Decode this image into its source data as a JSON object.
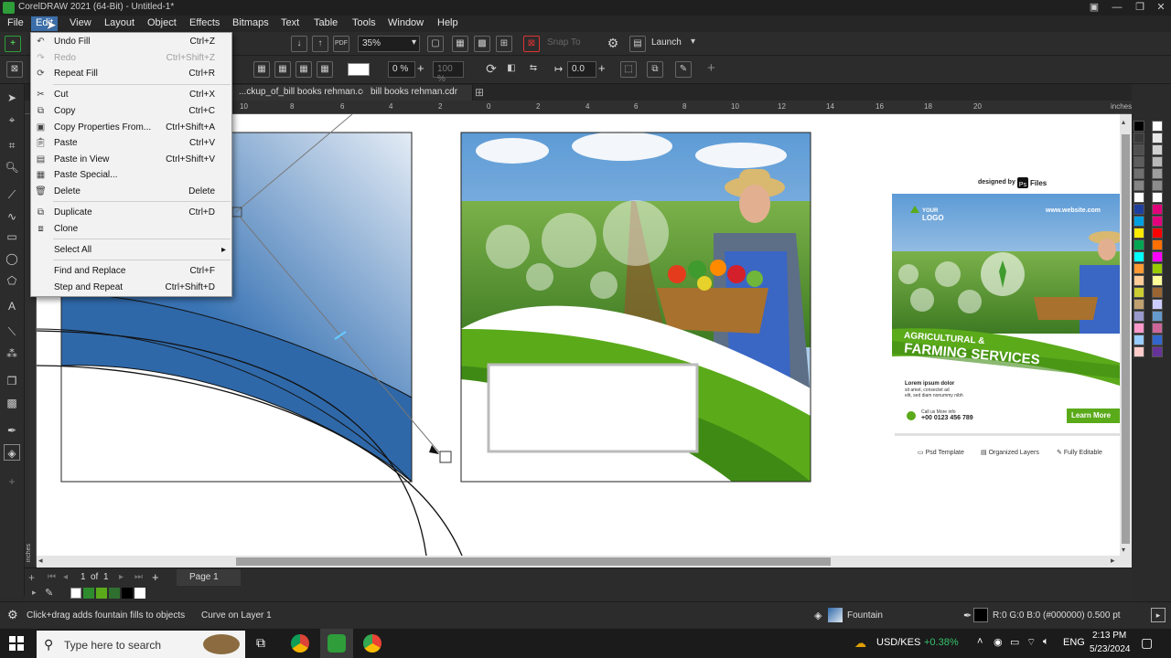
{
  "app": {
    "title": "CorelDRAW 2021 (64-Bit) - Untitled-1*"
  },
  "menubar": {
    "items": [
      "File",
      "Edit",
      "View",
      "Layout",
      "Object",
      "Effects",
      "Bitmaps",
      "Text",
      "Table",
      "Tools",
      "Window",
      "Help"
    ]
  },
  "toolbar1": {
    "zoom": "35%",
    "snap_label": "Snap To",
    "launch_label": "Launch"
  },
  "toolbar2": {
    "opacity1": "0 %",
    "opacity2": "100 %",
    "angle": "0.0"
  },
  "tabs": [
    "...ckup_of_bill books rehman.cdr",
    "bill books rehman.cdr"
  ],
  "ruler": {
    "unit": "inches",
    "ticks": [
      "10",
      "8",
      "6",
      "4",
      "2",
      "0",
      "2",
      "4",
      "6",
      "8",
      "10",
      "12",
      "14",
      "16",
      "18",
      "20"
    ]
  },
  "vruler_unit": "inches",
  "edit_menu": {
    "items": [
      {
        "label": "Undo Fill",
        "shortcut": "Ctrl+Z",
        "icon": "undo-icon",
        "disabled": false
      },
      {
        "label": "Redo",
        "shortcut": "Ctrl+Shift+Z",
        "icon": "redo-icon",
        "disabled": true
      },
      {
        "label": "Repeat Fill",
        "shortcut": "Ctrl+R",
        "icon": "repeat-icon",
        "disabled": false
      },
      {
        "label": "Cut",
        "shortcut": "Ctrl+X",
        "icon": "cut-icon",
        "disabled": false
      },
      {
        "label": "Copy",
        "shortcut": "Ctrl+C",
        "icon": "copy-icon",
        "disabled": false
      },
      {
        "label": "Copy Properties From...",
        "shortcut": "Ctrl+Shift+A",
        "icon": "copy-properties-icon",
        "disabled": false
      },
      {
        "label": "Paste",
        "shortcut": "Ctrl+V",
        "icon": "paste-icon",
        "disabled": false
      },
      {
        "label": "Paste in View",
        "shortcut": "Ctrl+Shift+V",
        "icon": "paste-in-view-icon",
        "disabled": false
      },
      {
        "label": "Paste Special...",
        "shortcut": "",
        "icon": "paste-special-icon",
        "disabled": false
      },
      {
        "label": "Delete",
        "shortcut": "Delete",
        "icon": "delete-icon",
        "disabled": false
      },
      {
        "label": "Duplicate",
        "shortcut": "Ctrl+D",
        "icon": "duplicate-icon",
        "disabled": false
      },
      {
        "label": "Clone",
        "shortcut": "",
        "icon": "clone-icon",
        "disabled": false
      },
      {
        "label": "Select All",
        "shortcut": "",
        "icon": "",
        "disabled": false,
        "submenu": true
      },
      {
        "label": "Find and Replace",
        "shortcut": "Ctrl+F",
        "icon": "",
        "disabled": false
      },
      {
        "label": "Step and Repeat",
        "shortcut": "Ctrl+Shift+D",
        "icon": "",
        "disabled": false
      }
    ]
  },
  "flyer": {
    "designed_by": "designed by",
    "brand": "Files",
    "logo_line1": "YOUR",
    "logo_line2": "LOGO",
    "website": "www.website.com",
    "headline1": "AGRICULTURAL &",
    "headline2": "FARMING SERVICES",
    "lorem1": "Lorem ipsum dolor",
    "lorem2": "sit amet, consectet ad",
    "lorem3": "elit, sed diam nonummy nibh",
    "call_label": "Call us More info",
    "phone": "+00 0123 456 789",
    "cta": "Learn More",
    "features": [
      "Psd Template",
      "Organized Layers",
      "Fully Editable"
    ]
  },
  "pagenav": {
    "current": "1",
    "of": "of",
    "total": "1",
    "page_label": "Page 1"
  },
  "status": {
    "hint": "Click+drag adds fountain fills to objects",
    "selection": "Curve on Layer 1",
    "fill": "Fountain",
    "outline": "R:0 G:0 B:0 (#000000)  0.500 pt"
  },
  "taskbar": {
    "search_placeholder": "Type here to search",
    "currency": "USD/KES",
    "change": "+0.38%",
    "lang": "ENG",
    "time": "2:13 PM",
    "date": "5/23/2024"
  },
  "colors": {
    "accent": "#3b6ea8",
    "green": "#4caf1e",
    "blue_fill": "#2f68a8"
  },
  "palette": [
    "#000000",
    "#ffffff",
    "#3a3a3a",
    "#e8e8e8",
    "#4f4f4f",
    "#d1d1d1",
    "#5d5d5d",
    "#b9b9b9",
    "#707070",
    "#9e9e9e",
    "#858585",
    "#8c8c8c",
    "#ffffff",
    "#ffffff",
    "#1f3f9e",
    "#e0007a",
    "#00a0e0",
    "#e4007c",
    "#ffea00",
    "#ff0000",
    "#00a651",
    "#ff6f00",
    "#00ffff",
    "#ff00ff",
    "#ff9933",
    "#99cc00",
    "#ffcc99",
    "#ffff99",
    "#cccc33",
    "#996633",
    "#c0a070",
    "#ccccff",
    "#9999cc",
    "#6699cc",
    "#ff99cc",
    "#cc6699",
    "#99ccff",
    "#3366cc",
    "#ffcccc",
    "#663399"
  ]
}
